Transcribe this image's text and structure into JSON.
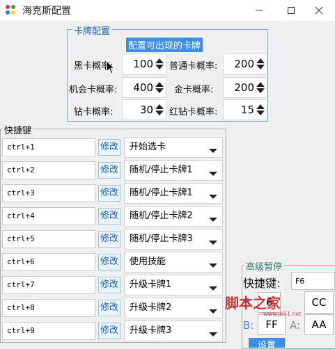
{
  "window": {
    "title": "海克斯配置",
    "minimize_icon": "minimize-icon",
    "maximize_icon": "maximize-icon",
    "close_icon": "close-icon"
  },
  "card_config": {
    "legend": "卡牌配置",
    "banner": "配置可出现的卡牌",
    "fields": [
      {
        "label": "黑卡概率:",
        "value": "100"
      },
      {
        "label": "普通卡概率:",
        "value": "200"
      },
      {
        "label": "机会卡概率:",
        "value": "400"
      },
      {
        "label": "金卡概率:",
        "value": "200"
      },
      {
        "label": "钻卡概率:",
        "value": "30"
      },
      {
        "label": "红钻卡概率:",
        "value": "15"
      }
    ]
  },
  "shortcuts": {
    "legend": "快捷键",
    "edit_label": "修改",
    "rows": [
      {
        "key": "ctrl+1",
        "action": "开始选卡"
      },
      {
        "key": "ctrl+2",
        "action": "随机/停止卡牌1"
      },
      {
        "key": "ctrl+3",
        "action": "随机/停止卡牌1"
      },
      {
        "key": "ctrl+4",
        "action": "随机/停止卡牌2"
      },
      {
        "key": "ctrl+5",
        "action": "随机/停止卡牌3"
      },
      {
        "key": "ctrl+6",
        "action": "使用技能"
      },
      {
        "key": "ctrl+7",
        "action": "升级卡牌1"
      },
      {
        "key": "ctrl+8",
        "action": "升级卡牌2"
      },
      {
        "key": "ctrl+9",
        "action": "升级卡牌3"
      }
    ]
  },
  "advanced_pause": {
    "legend": "高级暂停",
    "hotkey_label": "快捷键:",
    "hotkey_value": "F6",
    "r_label": "R",
    "r_value": "6",
    "cc_value": "CC",
    "b_label": "B:",
    "b_value": "FF",
    "a_label": "A:",
    "a_value": "AA",
    "set_label": "设置"
  },
  "watermark": {
    "text": "脚本之家",
    "url": "www.jb51.net"
  },
  "colors": {
    "accent": "#3d8ee5",
    "group_border": "#7aa9d8",
    "watermark": "#c3161c"
  }
}
